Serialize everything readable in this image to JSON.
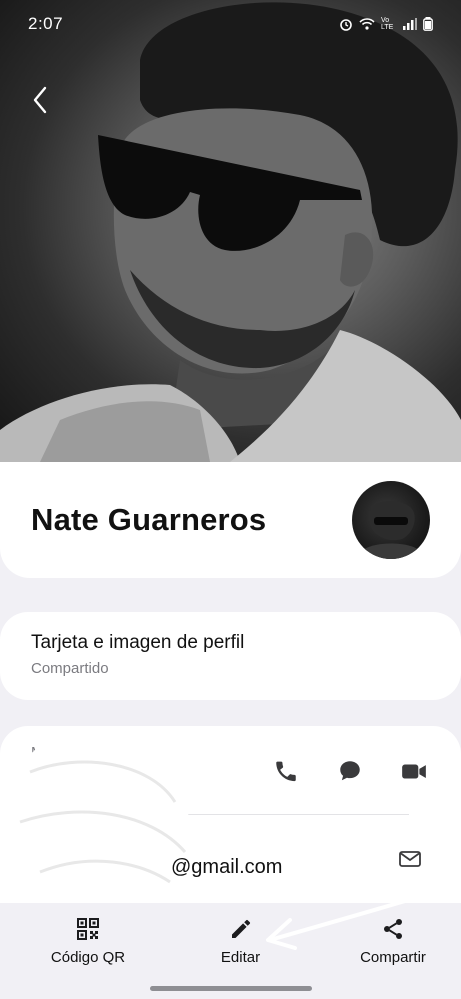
{
  "status_bar": {
    "time": "2:07",
    "icons": [
      "alarm-icon",
      "wifi-icon",
      "volte-icon",
      "signal-icon",
      "battery-icon"
    ],
    "volte_text": "Vo LTE"
  },
  "hero": {
    "photo": "profile-photo",
    "back_icon": "chevron-left-icon"
  },
  "contact": {
    "name": "Nate Guarneros"
  },
  "profile_card": {
    "title": "Tarjeta e imagen de perfil",
    "subtitle": "Compartido"
  },
  "phone": {
    "label": "M",
    "number": "",
    "actions": [
      "phone-icon",
      "message-icon",
      "video-call-icon"
    ]
  },
  "email": {
    "label": "",
    "value": "@gmail.com",
    "action": "email-icon"
  },
  "bottom_bar": {
    "items": [
      {
        "label": "Código QR",
        "icon": "qr-code-icon"
      },
      {
        "label": "Editar",
        "icon": "pencil-icon"
      },
      {
        "label": "Compartir",
        "icon": "share-icon"
      }
    ]
  },
  "colors": {
    "background": "#f1f0f5",
    "card": "#ffffff",
    "secondary_text": "#7b7b80",
    "icon": "#3a3a3c"
  }
}
